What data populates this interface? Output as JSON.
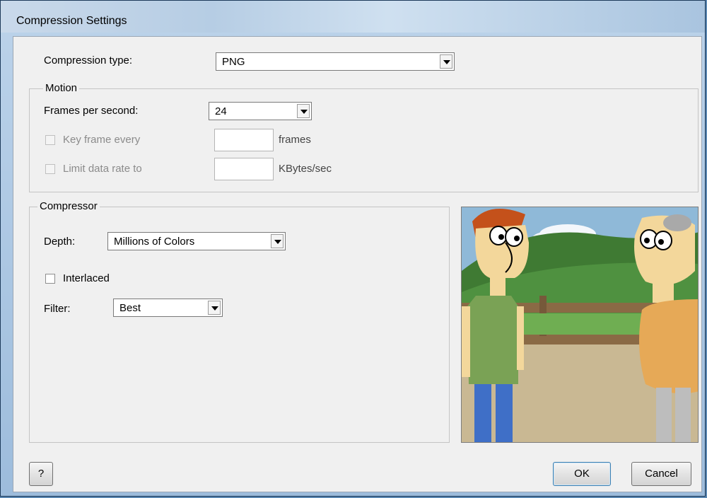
{
  "window": {
    "title": "Compression Settings"
  },
  "compression": {
    "label": "Compression type:",
    "value": "PNG"
  },
  "motion": {
    "group_label": "Motion",
    "fps_label": "Frames per second:",
    "fps_value": "24",
    "keyframe_label": "Key frame every",
    "keyframe_value": "",
    "keyframe_unit": "frames",
    "datarate_label": "Limit data rate to",
    "datarate_value": "",
    "datarate_unit": "KBytes/sec"
  },
  "compressor": {
    "group_label": "Compressor",
    "depth_label": "Depth:",
    "depth_value": "Millions of Colors",
    "interlaced_label": "Interlaced",
    "interlaced_checked": false,
    "filter_label": "Filter:",
    "filter_value": "Best"
  },
  "buttons": {
    "help": "?",
    "ok": "OK",
    "cancel": "Cancel"
  },
  "colors": {
    "dialog_bg": "#f0f0f0",
    "titlebar": "#b6cde4",
    "default_button_border": "#3c7fb1"
  }
}
